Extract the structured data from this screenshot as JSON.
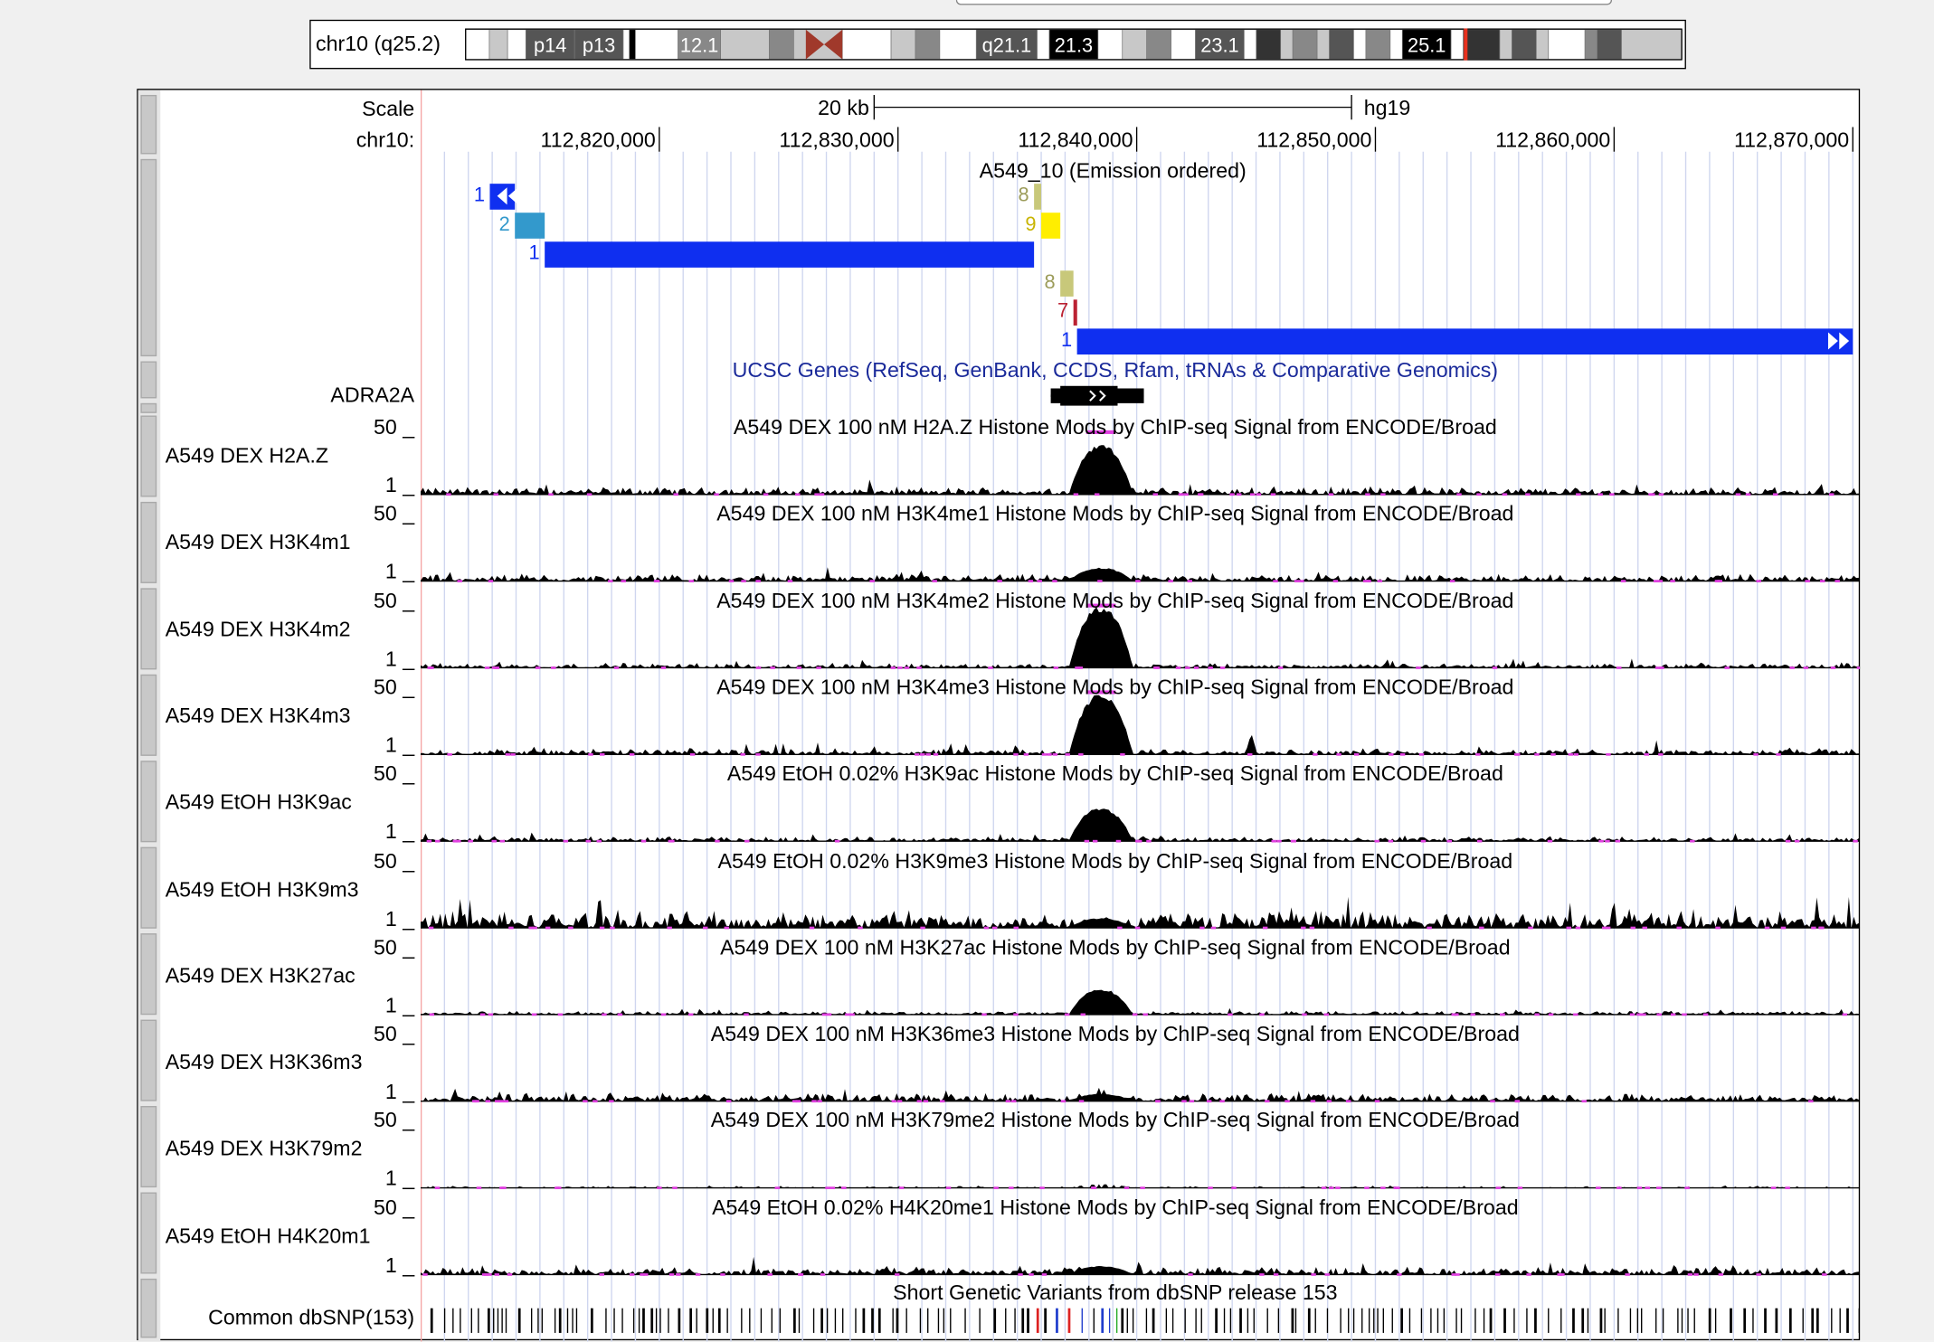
{
  "ideogram": {
    "chrom_label": "chr10 (q25.2)",
    "bands": [
      {
        "s": 0,
        "e": 2,
        "shade": "#ffffff"
      },
      {
        "s": 2,
        "e": 3.5,
        "shade": "#c8c8c8"
      },
      {
        "s": 3.5,
        "e": 5,
        "shade": "#ffffff"
      },
      {
        "s": 5,
        "e": 9,
        "shade": "#555555",
        "label": "p14"
      },
      {
        "s": 9,
        "e": 13,
        "shade": "#555555",
        "label": "p13"
      },
      {
        "s": 13,
        "e": 13.5,
        "shade": "#ffffff"
      },
      {
        "s": 13.5,
        "e": 14,
        "shade": "#000000"
      },
      {
        "s": 14,
        "e": 17.5,
        "shade": "#ffffff"
      },
      {
        "s": 17.5,
        "e": 21,
        "shade": "#888888",
        "label": "12.1"
      },
      {
        "s": 21,
        "e": 25,
        "shade": "#c8c8c8"
      },
      {
        "s": 25,
        "e": 27,
        "shade": "#888888"
      },
      {
        "s": 27,
        "e": 31,
        "shade": "#c8c8c8"
      },
      {
        "s": 31,
        "e": 35,
        "shade": "#ffffff"
      },
      {
        "s": 35,
        "e": 37,
        "shade": "#c8c8c8"
      },
      {
        "s": 37,
        "e": 39,
        "shade": "#888888"
      },
      {
        "s": 39,
        "e": 42,
        "shade": "#ffffff"
      },
      {
        "s": 42,
        "e": 47,
        "shade": "#555555",
        "label": "q21.1"
      },
      {
        "s": 47,
        "e": 48,
        "shade": "#ffffff"
      },
      {
        "s": 48,
        "e": 52,
        "shade": "#000000",
        "label": "21.3"
      },
      {
        "s": 52,
        "e": 54,
        "shade": "#ffffff"
      },
      {
        "s": 54,
        "e": 56,
        "shade": "#c8c8c8"
      },
      {
        "s": 56,
        "e": 58,
        "shade": "#888888"
      },
      {
        "s": 58,
        "e": 60,
        "shade": "#ffffff"
      },
      {
        "s": 60,
        "e": 64,
        "shade": "#555555",
        "label": "23.1"
      },
      {
        "s": 64,
        "e": 65,
        "shade": "#ffffff"
      },
      {
        "s": 65,
        "e": 67,
        "shade": "#333333"
      },
      {
        "s": 67,
        "e": 68,
        "shade": "#c8c8c8"
      },
      {
        "s": 68,
        "e": 70,
        "shade": "#888888"
      },
      {
        "s": 70,
        "e": 71,
        "shade": "#c8c8c8"
      },
      {
        "s": 71,
        "e": 73,
        "shade": "#555555"
      },
      {
        "s": 73,
        "e": 74,
        "shade": "#ffffff"
      },
      {
        "s": 74,
        "e": 76,
        "shade": "#888888"
      },
      {
        "s": 76,
        "e": 77,
        "shade": "#ffffff"
      },
      {
        "s": 77,
        "e": 81,
        "shade": "#000000",
        "label": "25.1"
      },
      {
        "s": 81,
        "e": 82,
        "shade": "#ffffff"
      },
      {
        "s": 82,
        "e": 85,
        "shade": "#333333"
      },
      {
        "s": 85,
        "e": 86,
        "shade": "#c8c8c8"
      },
      {
        "s": 86,
        "e": 88,
        "shade": "#555555"
      },
      {
        "s": 88,
        "e": 89,
        "shade": "#c8c8c8"
      },
      {
        "s": 89,
        "e": 92,
        "shade": "#ffffff"
      },
      {
        "s": 92,
        "e": 93,
        "shade": "#888888"
      },
      {
        "s": 93,
        "e": 95,
        "shade": "#555555"
      },
      {
        "s": 95,
        "e": 100,
        "shade": "#c8c8c8"
      }
    ],
    "centromere": {
      "s": 28,
      "e": 31
    },
    "position_marker": 82.2,
    "marker_color": "#e8321f"
  },
  "ruler": {
    "scale_label": "Scale",
    "chrom_label": "chr10:",
    "scale_bar_text": "20 kb",
    "assembly": "hg19",
    "positions": [
      "112,820,000",
      "112,830,000",
      "112,840,000",
      "112,850,000",
      "112,860,000",
      "112,870,000"
    ]
  },
  "chromhmm": {
    "title": "A549_10 (Emission ordered)",
    "features": [
      {
        "label": "1",
        "start": 112812900,
        "end": 112813950,
        "color": "#0f2ff0",
        "text_color": "#0f2ff0",
        "row": 0,
        "arrows": "left"
      },
      {
        "label": "2",
        "start": 112813950,
        "end": 112815200,
        "color": "#3399cc",
        "text_color": "#3399cc",
        "row": 1
      },
      {
        "label": "1",
        "start": 112815200,
        "end": 112835700,
        "color": "#0f2ff0",
        "text_color": "#0f2ff0",
        "row": 2
      },
      {
        "label": "8",
        "start": 112835700,
        "end": 112836000,
        "color": "#c8c87a",
        "text_color": "#9c9c5a",
        "row": 0
      },
      {
        "label": "9",
        "start": 112836000,
        "end": 112836800,
        "color": "#ffee00",
        "text_color": "#c8b400",
        "row": 1
      },
      {
        "label": "8",
        "start": 112836800,
        "end": 112837350,
        "color": "#c8c87a",
        "text_color": "#9c9c5a",
        "row": 3
      },
      {
        "label": "7",
        "start": 112837350,
        "end": 112837500,
        "color": "#bb2233",
        "text_color": "#bb2233",
        "row": 4
      },
      {
        "label": "1",
        "start": 112837500,
        "end": 112870000,
        "color": "#0f2ff0",
        "text_color": "#0f2ff0",
        "row": 5,
        "arrows": "right"
      }
    ]
  },
  "genes": {
    "title": "UCSC Genes (RefSeq, GenBank, CCDS, Rfam, tRNAs & Comparative Genomics)",
    "name": "ADRA2A",
    "start": 112836400,
    "end": 112840300,
    "cds_start": 112836800,
    "cds_end": 112839200,
    "strand": "+"
  },
  "signal_tracks": [
    {
      "label": "A549 DEX H2A.Z",
      "title": "A549 DEX 100 nM H2A.Z Histone Mods by ChIP-seq Signal from ENCODE/Broad",
      "max": "50 _",
      "min": "1 _",
      "peak": 0.82,
      "baseline": 0.1,
      "extra_peaks": []
    },
    {
      "label": "A549 DEX H3K4m1",
      "title": "A549 DEX 100 nM H3K4me1 Histone Mods by ChIP-seq Signal from ENCODE/Broad",
      "max": "50 _",
      "min": "1 _",
      "peak": 0.22,
      "baseline": 0.09,
      "extra_peaks": []
    },
    {
      "label": "A549 DEX H3K4m2",
      "title": "A549 DEX 100 nM H3K4me2 Histone Mods by ChIP-seq Signal from ENCODE/Broad",
      "max": "50 _",
      "min": "1 _",
      "peak": 1.0,
      "baseline": 0.06,
      "extra_peaks": []
    },
    {
      "label": "A549 DEX H3K4m3",
      "title": "A549 DEX 100 nM H3K4me3 Histone Mods by ChIP-seq Signal from ENCODE/Broad",
      "max": "50 _",
      "min": "1 _",
      "peak": 1.0,
      "baseline": 0.08,
      "extra_peaks": [
        {
          "at": 112844800,
          "h": 0.35
        }
      ]
    },
    {
      "label": "A549 EtOH H3K9ac",
      "title": "A549 EtOH 0.02% H3K9ac Histone Mods by ChIP-seq Signal from ENCODE/Broad",
      "max": "50 _",
      "min": "1 _",
      "peak": 0.55,
      "baseline": 0.06,
      "extra_peaks": []
    },
    {
      "label": "A549 EtOH H3K9m3",
      "title": "A549 EtOH 0.02% H3K9me3 Histone Mods by ChIP-seq Signal from ENCODE/Broad",
      "max": "50 _",
      "min": "1 _",
      "peak": 0.16,
      "baseline": 0.22,
      "extra_peaks": []
    },
    {
      "label": "A549 DEX H3K27ac",
      "title": "A549 DEX 100 nM H3K27ac Histone Mods by ChIP-seq Signal from ENCODE/Broad",
      "max": "50 _",
      "min": "1 _",
      "peak": 0.42,
      "baseline": 0.05,
      "extra_peaks": []
    },
    {
      "label": "A549 DEX H3K36m3",
      "title": "A549 DEX 100 nM H3K36me3 Histone Mods by ChIP-seq Signal from ENCODE/Broad",
      "max": "50 _",
      "min": "1 _",
      "peak": 0.12,
      "baseline": 0.11,
      "extra_peaks": []
    },
    {
      "label": "A549 DEX H3K79m2",
      "title": "A549 DEX 100 nM H3K79me2 Histone Mods by ChIP-seq Signal from ENCODE/Broad",
      "max": "50 _",
      "min": "1 _",
      "peak": 0.06,
      "baseline": 0.03,
      "extra_peaks": []
    },
    {
      "label": "A549 EtOH H4K20m1",
      "title": "A549 EtOH 0.02% H4K20me1 Histone Mods by ChIP-seq Signal from ENCODE/Broad",
      "max": "50 _",
      "min": "1 _",
      "peak": 0.14,
      "baseline": 0.1,
      "extra_peaks": []
    }
  ],
  "snp": {
    "label": "Common dbSNP(153)",
    "title": "Short Genetic Variants from dbSNP release 153",
    "colors": {
      "default": "#000000",
      "blue": "#1f3dcc",
      "green": "#22aa22",
      "red": "#dd2222"
    }
  },
  "view": {
    "start": 112810000,
    "end": 112870300
  },
  "colors": {
    "clip_mark": "#e040e0",
    "grid": "#cfd6ef",
    "red_edge": "#f4a4a4"
  }
}
